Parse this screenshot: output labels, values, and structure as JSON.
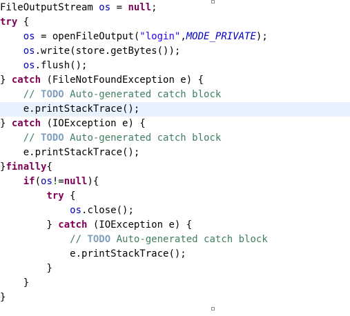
{
  "colors": {
    "background": "#ffffff",
    "current_line": "#e8f2fe",
    "keyword": "#7f0055",
    "string": "#2a00ff",
    "constant": "#0000c0",
    "field": "#0000c0",
    "comment": "#3f7f5f",
    "todo": "#7f9fbf",
    "plain": "#000000"
  },
  "code": {
    "lines": [
      [
        "",
        "FileOutputStream ",
        "os",
        " = ",
        "null",
        ";"
      ],
      [
        "",
        "try",
        " {"
      ],
      [
        "    ",
        "os",
        " = openFileOutput(",
        "\"login\"",
        ",",
        "MODE_PRIVATE",
        ");"
      ],
      [
        "    ",
        "os",
        ".write(store.getBytes());"
      ],
      [
        "    ",
        "os",
        ".flush();"
      ],
      [
        "",
        "} ",
        "catch",
        " (FileNotFoundException e) {"
      ],
      [
        "    ",
        "// ",
        "TODO",
        " Auto-generated catch block"
      ],
      [
        "    ",
        "e.printStackTrace();"
      ],
      [
        "",
        "} ",
        "catch",
        " (IOException e) {"
      ],
      [
        "    ",
        "// ",
        "TODO",
        " Auto-generated catch block"
      ],
      [
        "    ",
        "e.printStackTrace();"
      ],
      [
        "",
        "}",
        "finally",
        "{"
      ],
      [
        "    ",
        "if",
        "(",
        "os",
        "!=",
        "null",
        "){"
      ],
      [
        "        ",
        "try",
        " {"
      ],
      [
        "            ",
        "os",
        ".close();"
      ],
      [
        "        ",
        "} ",
        "catch",
        " (IOException e) {"
      ],
      [
        "            ",
        "// ",
        "TODO",
        " Auto-generated catch block"
      ],
      [
        "            ",
        "e.printStackTrace();"
      ],
      [
        "        ",
        "}"
      ],
      [
        "    ",
        "}"
      ],
      [
        "",
        "}"
      ]
    ]
  }
}
